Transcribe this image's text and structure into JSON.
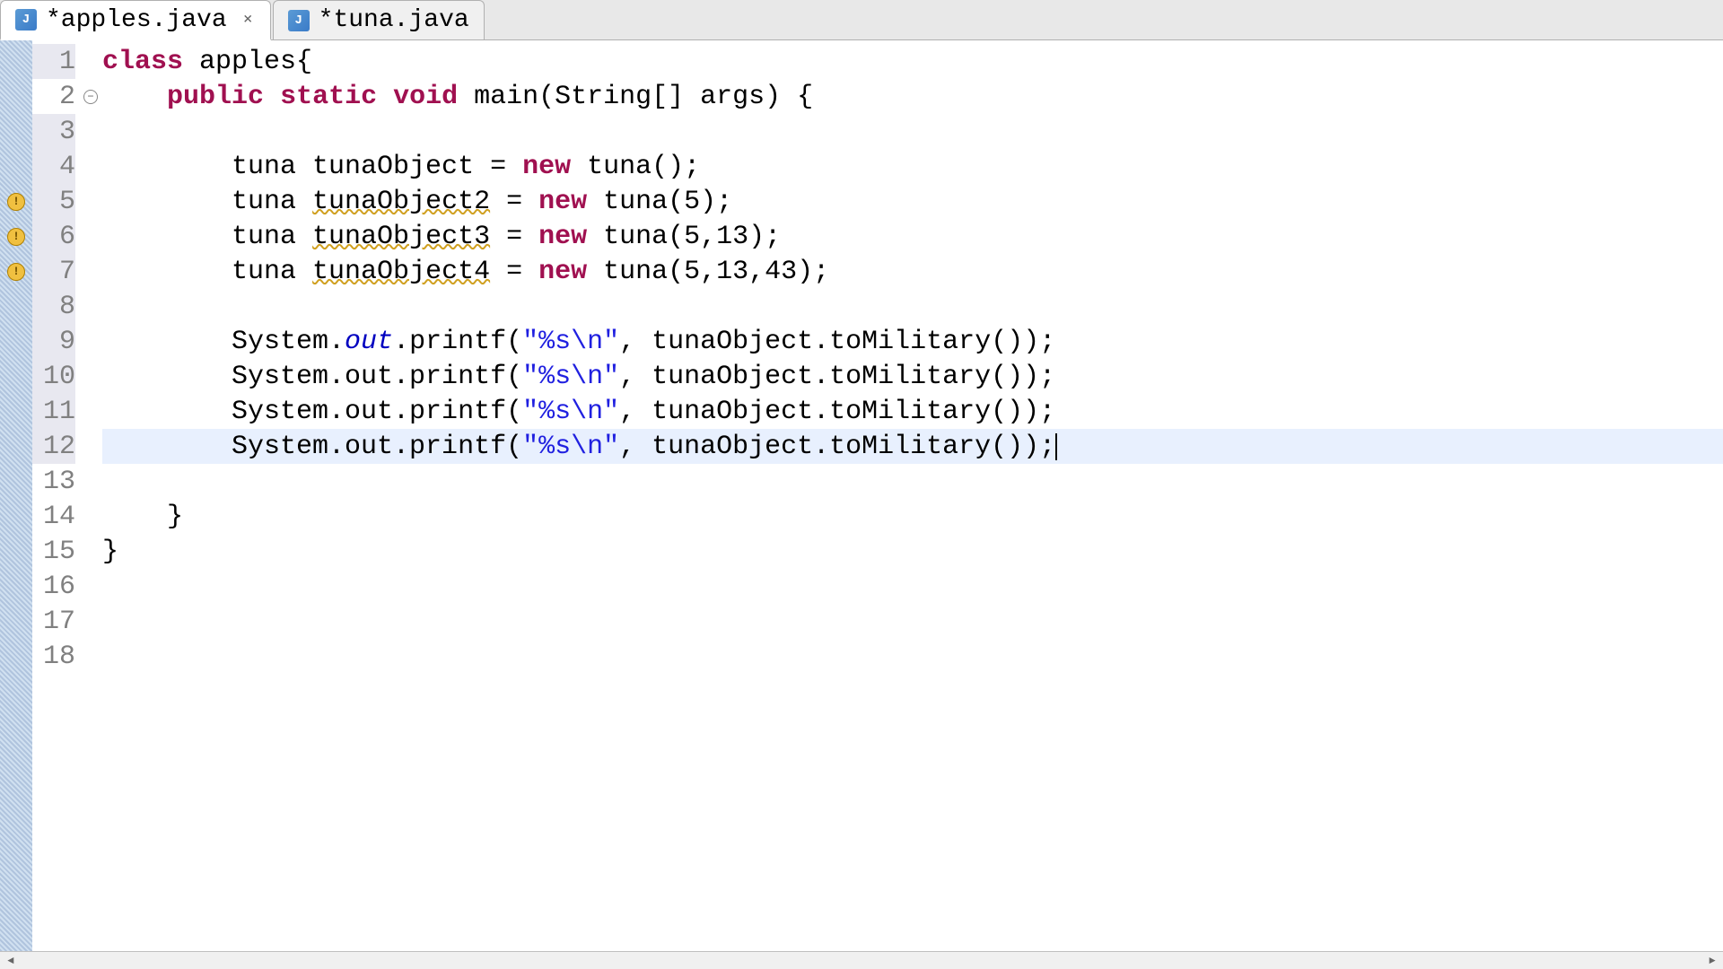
{
  "tabs": [
    {
      "label": "*apples.java",
      "active": true,
      "hasClose": true
    },
    {
      "label": "*tuna.java",
      "active": false,
      "hasClose": false
    }
  ],
  "lines": [
    {
      "num": "1",
      "highlight": true,
      "marker": null,
      "fold": null,
      "tokens": [
        {
          "t": "class",
          "c": "keyword"
        },
        {
          "t": " apples{",
          "c": ""
        }
      ]
    },
    {
      "num": "2",
      "highlight": false,
      "marker": null,
      "fold": "collapse",
      "tokens": [
        {
          "t": "    ",
          "c": ""
        },
        {
          "t": "public",
          "c": "keyword"
        },
        {
          "t": " ",
          "c": ""
        },
        {
          "t": "static",
          "c": "keyword"
        },
        {
          "t": " ",
          "c": ""
        },
        {
          "t": "void",
          "c": "keyword"
        },
        {
          "t": " main(String[] args) {",
          "c": ""
        }
      ]
    },
    {
      "num": "3",
      "highlight": true,
      "marker": null,
      "fold": null,
      "tokens": [
        {
          "t": "",
          "c": ""
        }
      ]
    },
    {
      "num": "4",
      "highlight": true,
      "marker": null,
      "fold": null,
      "tokens": [
        {
          "t": "        tuna tunaObject = ",
          "c": ""
        },
        {
          "t": "new",
          "c": "keyword"
        },
        {
          "t": " tuna();",
          "c": ""
        }
      ]
    },
    {
      "num": "5",
      "highlight": true,
      "marker": "warning",
      "fold": null,
      "tokens": [
        {
          "t": "        tuna ",
          "c": ""
        },
        {
          "t": "tunaObject2",
          "c": "warning-underline"
        },
        {
          "t": " = ",
          "c": ""
        },
        {
          "t": "new",
          "c": "keyword"
        },
        {
          "t": " tuna(5);",
          "c": ""
        }
      ]
    },
    {
      "num": "6",
      "highlight": true,
      "marker": "warning",
      "fold": null,
      "tokens": [
        {
          "t": "        tuna ",
          "c": ""
        },
        {
          "t": "tunaObject3",
          "c": "warning-underline"
        },
        {
          "t": " = ",
          "c": ""
        },
        {
          "t": "new",
          "c": "keyword"
        },
        {
          "t": " tuna(5,13);",
          "c": ""
        }
      ]
    },
    {
      "num": "7",
      "highlight": true,
      "marker": "warning",
      "fold": null,
      "tokens": [
        {
          "t": "        tuna ",
          "c": ""
        },
        {
          "t": "tunaObject4",
          "c": "warning-underline"
        },
        {
          "t": " = ",
          "c": ""
        },
        {
          "t": "new",
          "c": "keyword"
        },
        {
          "t": " tuna(5,13,43);",
          "c": ""
        }
      ]
    },
    {
      "num": "8",
      "highlight": true,
      "marker": null,
      "fold": null,
      "tokens": [
        {
          "t": "",
          "c": ""
        }
      ]
    },
    {
      "num": "9",
      "highlight": true,
      "marker": null,
      "fold": null,
      "tokens": [
        {
          "t": "        System.",
          "c": ""
        },
        {
          "t": "out",
          "c": "static-field"
        },
        {
          "t": ".printf(",
          "c": ""
        },
        {
          "t": "\"%s\\n\"",
          "c": "string"
        },
        {
          "t": ", tunaObject.toMilitary());",
          "c": ""
        }
      ]
    },
    {
      "num": "10",
      "highlight": true,
      "marker": null,
      "fold": null,
      "tokens": [
        {
          "t": "        System.out.printf(",
          "c": ""
        },
        {
          "t": "\"%s\\n\"",
          "c": "string"
        },
        {
          "t": ", tunaObject.toMilitary());",
          "c": ""
        }
      ]
    },
    {
      "num": "11",
      "highlight": true,
      "marker": null,
      "fold": null,
      "tokens": [
        {
          "t": "        System.out.printf(",
          "c": ""
        },
        {
          "t": "\"%s\\n\"",
          "c": "string"
        },
        {
          "t": ", tunaObject.toMilitary());",
          "c": ""
        }
      ]
    },
    {
      "num": "12",
      "highlight": true,
      "marker": null,
      "fold": null,
      "current": true,
      "tokens": [
        {
          "t": "        System.out.printf(",
          "c": ""
        },
        {
          "t": "\"%s\\n\"",
          "c": "string"
        },
        {
          "t": ", tunaObject.toMilitary());",
          "c": ""
        }
      ],
      "cursor": true
    },
    {
      "num": "13",
      "highlight": false,
      "marker": null,
      "fold": null,
      "tokens": [
        {
          "t": "",
          "c": ""
        }
      ]
    },
    {
      "num": "14",
      "highlight": false,
      "marker": null,
      "fold": null,
      "tokens": [
        {
          "t": "    }",
          "c": ""
        }
      ]
    },
    {
      "num": "15",
      "highlight": false,
      "marker": null,
      "fold": null,
      "tokens": [
        {
          "t": "}",
          "c": ""
        }
      ]
    },
    {
      "num": "16",
      "highlight": false,
      "marker": null,
      "fold": null,
      "tokens": [
        {
          "t": "",
          "c": ""
        }
      ]
    },
    {
      "num": "17",
      "highlight": false,
      "marker": null,
      "fold": null,
      "tokens": [
        {
          "t": "",
          "c": ""
        }
      ]
    },
    {
      "num": "18",
      "highlight": false,
      "marker": null,
      "fold": null,
      "tokens": [
        {
          "t": "",
          "c": ""
        }
      ]
    }
  ]
}
